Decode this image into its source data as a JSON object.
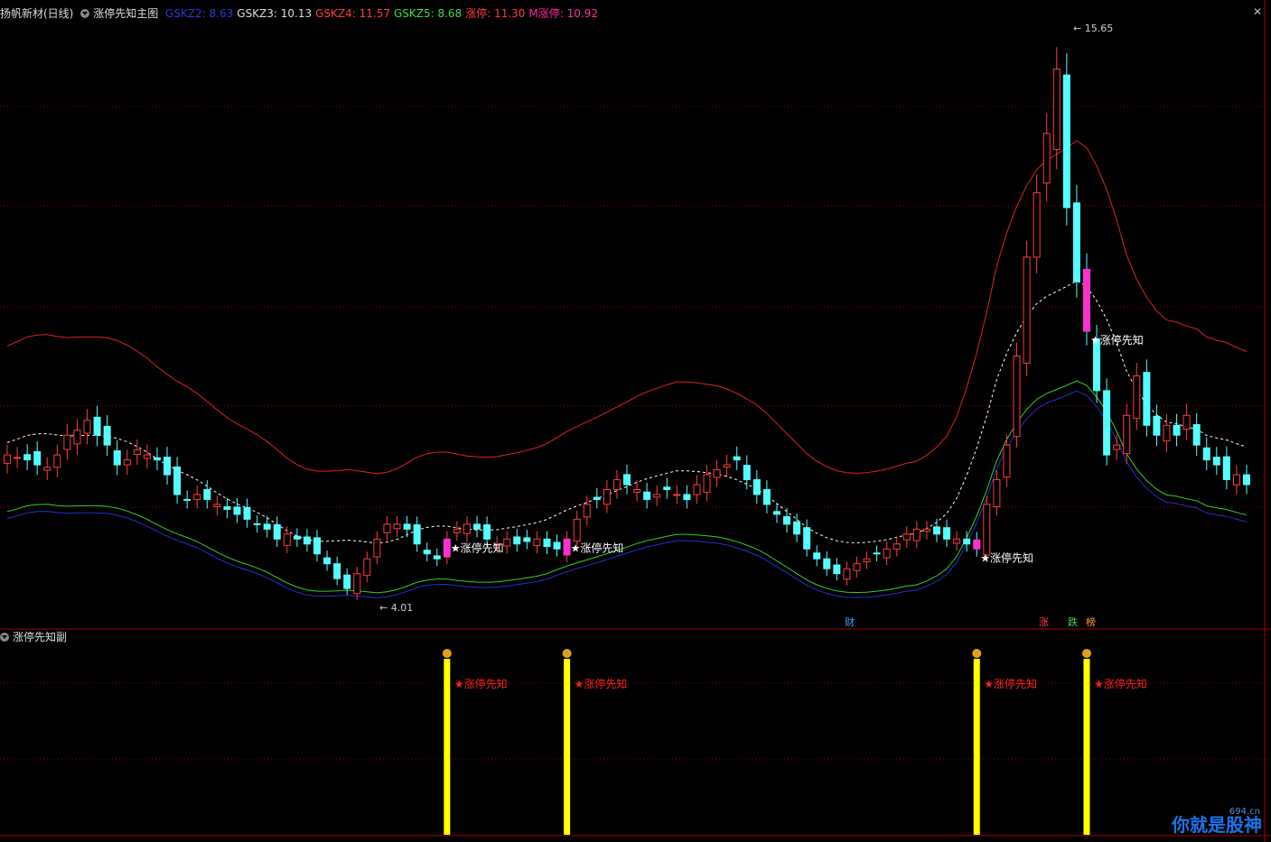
{
  "header": {
    "stock_title": "扬帆新材(日线)",
    "indicator_name": "涨停先知主图",
    "items": [
      {
        "label": "GSKZ2: 8.63",
        "color": "#2a3bd6"
      },
      {
        "label": "GSKZ3: 10.13",
        "color": "#dddddd"
      },
      {
        "label": "GSKZ4: 11.57",
        "color": "#ff3c3c"
      },
      {
        "label": "GSKZ5: 8.68",
        "color": "#3cdc3c"
      },
      {
        "label": "涨停: 11.30",
        "color": "#ff3c3c"
      },
      {
        "label": "M涨停: 10.92",
        "color": "#ff2aa0"
      }
    ]
  },
  "subpanel": {
    "title": "涨停先知副"
  },
  "annotations": {
    "high_label": "15.65",
    "low_label": "4.01",
    "signal_label": "★涨停先知",
    "signal_label_main": "涨停先知",
    "marker_cai": "财",
    "marker_zhang": "涨",
    "marker_die": "跌",
    "marker_bang": "榜"
  },
  "colors": {
    "background": "#000000",
    "up_candle": "#ff3c3c",
    "down_candle": "#54ffff",
    "upper_band": "#e02020",
    "mid_band": "#ffffff",
    "lower_band_green": "#30d030",
    "lower_band_blue": "#2030d0",
    "signal_bar": "#ffff00",
    "signal_candle": "#ff30d0",
    "grid": "#8b0000"
  },
  "logo": {
    "text": "你就是股神",
    "sub": "694.cn"
  },
  "chart_data": {
    "type": "candlestick",
    "price_range": [
      4.01,
      15.65
    ],
    "signal_indices": [
      44,
      56,
      97,
      108
    ]
  }
}
